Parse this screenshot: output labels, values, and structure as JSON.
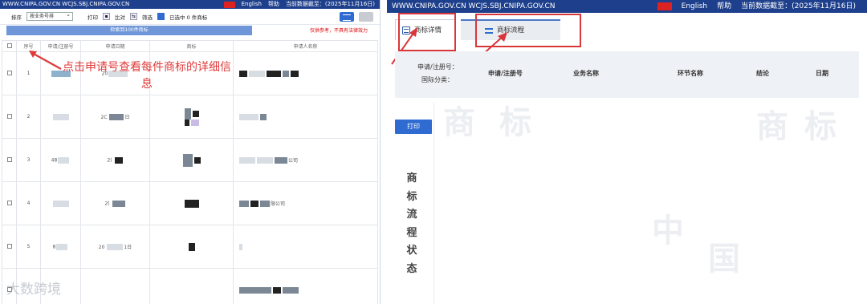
{
  "left": {
    "topbar": {
      "urls": "WWW.CNIPA.GOV.CN WCJS.SBJ.CNIPA.GOV.CN",
      "english": "English",
      "help": "帮助",
      "date_text": "当前数据截至：(2025年11月16日)"
    },
    "toolbar": {
      "sort_label": "排序",
      "sort_value": "按业务号排",
      "print_label": "打印",
      "compare_label": "比对",
      "filter_label": "筛选",
      "selected_text": "已选中 0 件商标"
    },
    "bluebar_text": "检索到100件商标",
    "red_tip": "仅供参考，不具有法律效力",
    "table": {
      "headers": [
        "序号",
        "申请/注册号",
        "申请日期",
        "商标",
        "申请人名称"
      ],
      "rows": [
        {
          "index": "1",
          "date": "20"
        },
        {
          "index": "2",
          "date": "2C",
          "date_suffix": "日"
        },
        {
          "index": "3",
          "reg_prefix": "48",
          "date": "2("
        },
        {
          "index": "4",
          "date": "2("
        },
        {
          "index": "5",
          "reg_prefix": "8",
          "date": "20",
          "date_suffix": "1日"
        },
        {
          "index": "",
          "date": ""
        }
      ],
      "applicant_suffixes": [
        "",
        "",
        "公司",
        "限公司",
        "",
        ""
      ]
    },
    "annotation": "点击申请号查看每件商标的详细信息",
    "watermark": "大数跨境"
  },
  "right": {
    "topbar": {
      "urls": "WWW.CNIPA.GOV.CN WCJS.SBJ.CNIPA.GOV.CN",
      "english": "English",
      "help": "帮助",
      "date_text": "当前数据截至：(2025年11月16日)"
    },
    "tabs": [
      {
        "label": "商标详情",
        "icon": "document-icon"
      },
      {
        "label": "商标流程",
        "icon": "list-icon"
      }
    ],
    "info": {
      "reg_label": "申请/注册号：",
      "intl_label": "国际分类：",
      "headers": [
        "申请/注册号",
        "业务名称",
        "环节名称",
        "结论",
        "日期"
      ]
    },
    "print_button": "打印",
    "vertical_title": [
      "商",
      "标",
      "流",
      "程",
      "状",
      "态"
    ],
    "watermarks": [
      "商",
      "标",
      "中",
      "国",
      "商",
      "标"
    ]
  },
  "colors": {
    "header_blue": "#1e3f8c",
    "accent_blue": "#2f6bd1",
    "annotation_red": "#d9363a"
  }
}
